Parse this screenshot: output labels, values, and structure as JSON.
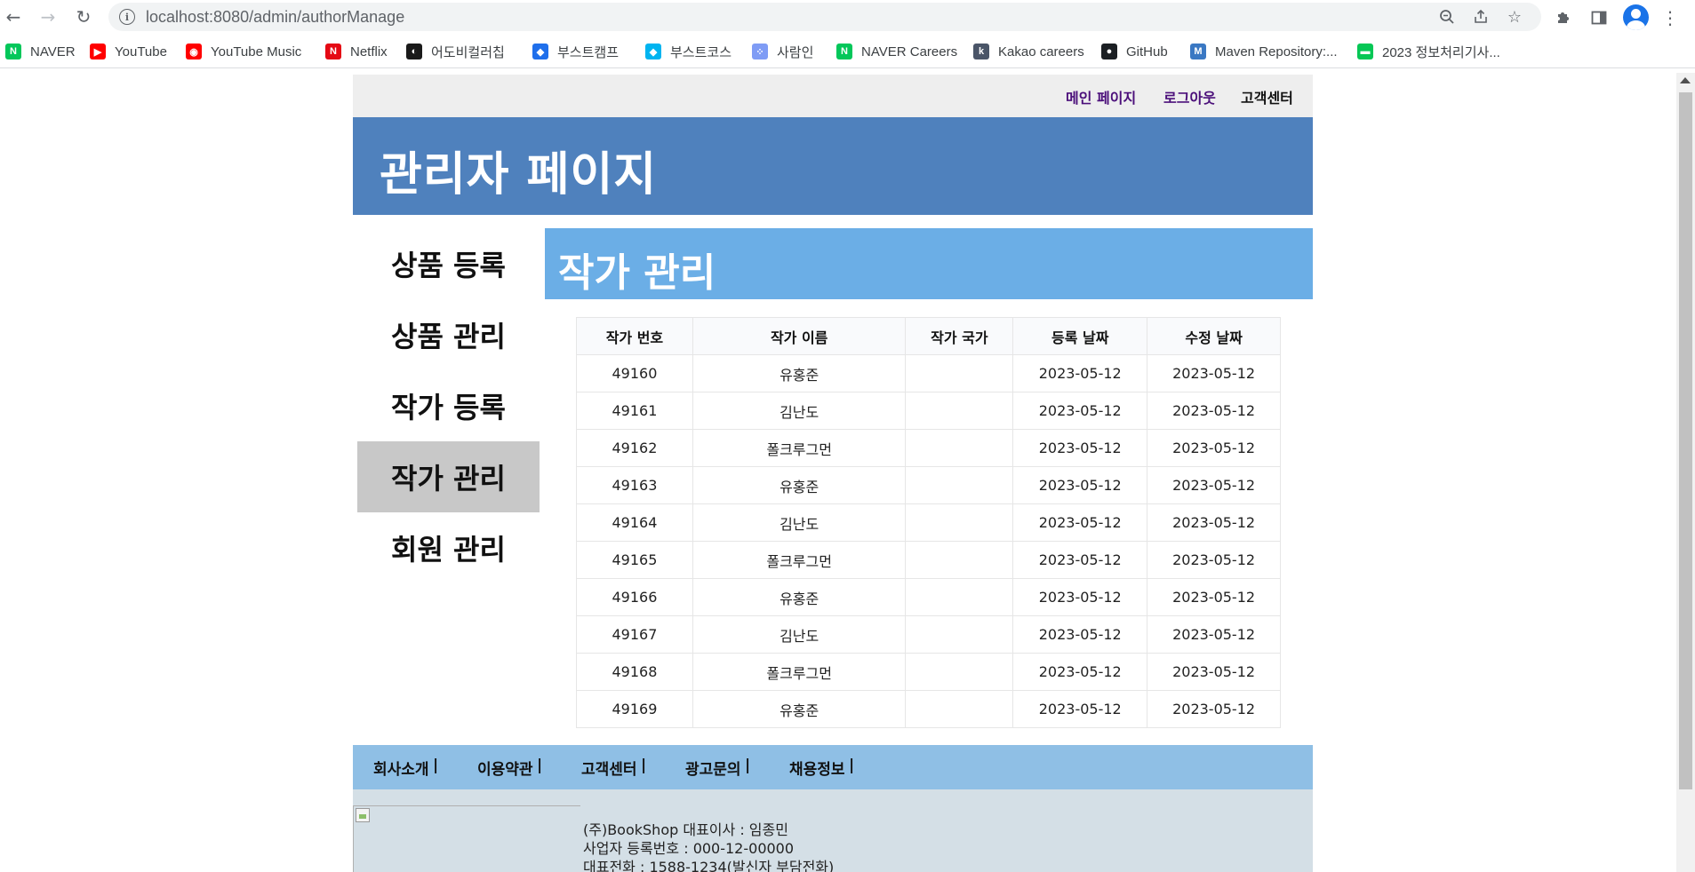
{
  "browser": {
    "url": "localhost:8080/admin/authorManage",
    "bookmarks": [
      {
        "label": "NAVER",
        "icon": "naver-icon",
        "color": "#03c75a",
        "glyph": "N"
      },
      {
        "label": "YouTube",
        "icon": "youtube-icon",
        "color": "#ff0000",
        "glyph": "▶"
      },
      {
        "label": "YouTube Music",
        "icon": "youtube-music-icon",
        "color": "#ff0000",
        "glyph": "◉"
      },
      {
        "label": "Netflix",
        "icon": "netflix-icon",
        "color": "#e50914",
        "glyph": "N"
      },
      {
        "label": "어도비컬러칩",
        "icon": "adobe-color-icon",
        "color": "#1a1a1a",
        "glyph": "◐"
      },
      {
        "label": "부스트캠프",
        "icon": "boostcamp-icon",
        "color": "#1f6feb",
        "glyph": "◆"
      },
      {
        "label": "부스트코스",
        "icon": "boostcourse-icon",
        "color": "#00b4f0",
        "glyph": "◆"
      },
      {
        "label": "사람인",
        "icon": "saramin-icon",
        "color": "#7f9cf5",
        "glyph": "⁘"
      },
      {
        "label": "NAVER Careers",
        "icon": "naver-careers-icon",
        "color": "#03c75a",
        "glyph": "N"
      },
      {
        "label": "Kakao careers",
        "icon": "kakao-careers-icon",
        "color": "#4a5568",
        "glyph": "k"
      },
      {
        "label": "GitHub",
        "icon": "github-icon",
        "color": "#1b1f23",
        "glyph": "●"
      },
      {
        "label": "Maven Repository:...",
        "icon": "maven-icon",
        "color": "#3a78c3",
        "glyph": "M"
      },
      {
        "label": "2023 정보처리기사...",
        "icon": "line-icon",
        "color": "#06c755",
        "glyph": "▬"
      }
    ]
  },
  "top_links": {
    "main_page": "메인 페이지",
    "logout": "로그아웃",
    "customer_center": "고객센터",
    "link_color": "#4b0f7a"
  },
  "header": {
    "title": "관리자 페이지"
  },
  "sidebar": {
    "items": [
      {
        "label": "상품 등록",
        "active": false
      },
      {
        "label": "상품 관리",
        "active": false
      },
      {
        "label": "작가 등록",
        "active": false
      },
      {
        "label": "작가 관리",
        "active": true
      },
      {
        "label": "회원 관리",
        "active": false
      }
    ]
  },
  "content": {
    "title": "작가 관리"
  },
  "table": {
    "columns": [
      "작가 번호",
      "작가 이름",
      "작가 국가",
      "등록 날짜",
      "수정 날짜"
    ],
    "rows": [
      [
        "49160",
        "유홍준",
        "",
        "2023-05-12",
        "2023-05-12"
      ],
      [
        "49161",
        "김난도",
        "",
        "2023-05-12",
        "2023-05-12"
      ],
      [
        "49162",
        "폴크루그먼",
        "",
        "2023-05-12",
        "2023-05-12"
      ],
      [
        "49163",
        "유홍준",
        "",
        "2023-05-12",
        "2023-05-12"
      ],
      [
        "49164",
        "김난도",
        "",
        "2023-05-12",
        "2023-05-12"
      ],
      [
        "49165",
        "폴크루그먼",
        "",
        "2023-05-12",
        "2023-05-12"
      ],
      [
        "49166",
        "유홍준",
        "",
        "2023-05-12",
        "2023-05-12"
      ],
      [
        "49167",
        "김난도",
        "",
        "2023-05-12",
        "2023-05-12"
      ],
      [
        "49168",
        "폴크루그먼",
        "",
        "2023-05-12",
        "2023-05-12"
      ],
      [
        "49169",
        "유홍준",
        "",
        "2023-05-12",
        "2023-05-12"
      ]
    ]
  },
  "footer": {
    "nav": [
      "회사소개",
      "이용약관",
      "고객센터",
      "광고문의",
      "채용정보"
    ],
    "separator": "|",
    "info": [
      "(주)BookShop 대표이사 : 임종민",
      "사업자 등록번호 : 000-12-00000",
      "대표전화 : 1588-1234(발신자 부담전화)"
    ]
  }
}
